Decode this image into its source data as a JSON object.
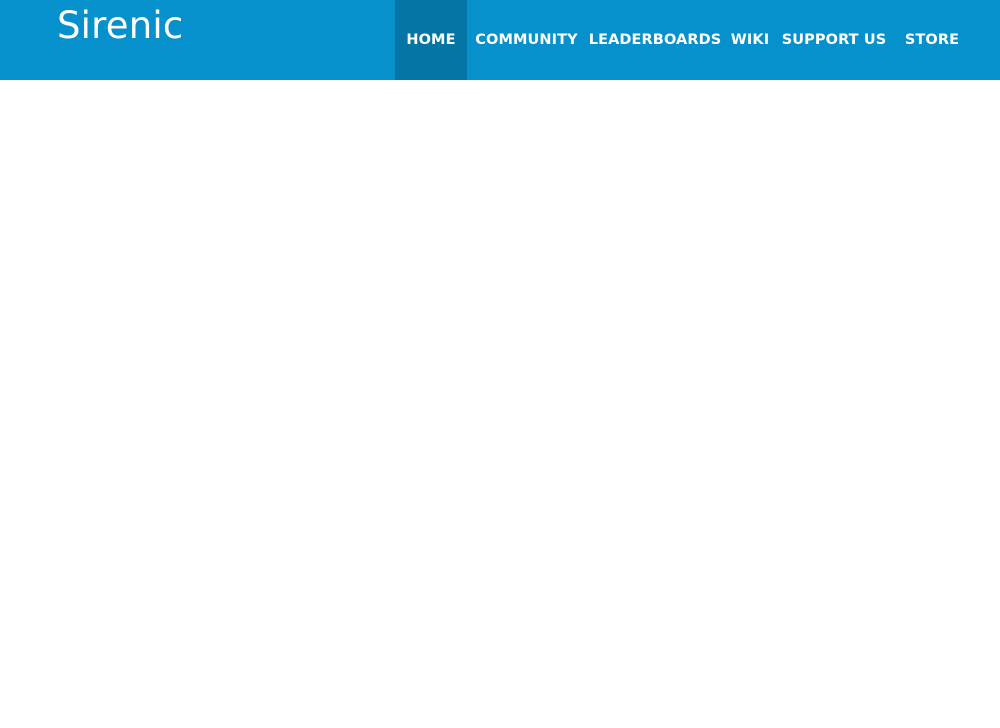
{
  "header": {
    "brand": "Sirenic",
    "background_color": "#0690cc",
    "active_color": "#0575a6"
  },
  "nav": {
    "items": [
      {
        "label": "HOME",
        "active": true
      },
      {
        "label": "COMMUNITY",
        "active": false
      },
      {
        "label": "LEADERBOARDS",
        "active": false
      },
      {
        "label": "WIKI",
        "active": false
      },
      {
        "label": "SUPPORT US",
        "active": false
      },
      {
        "label": "STORE",
        "active": false
      }
    ]
  }
}
